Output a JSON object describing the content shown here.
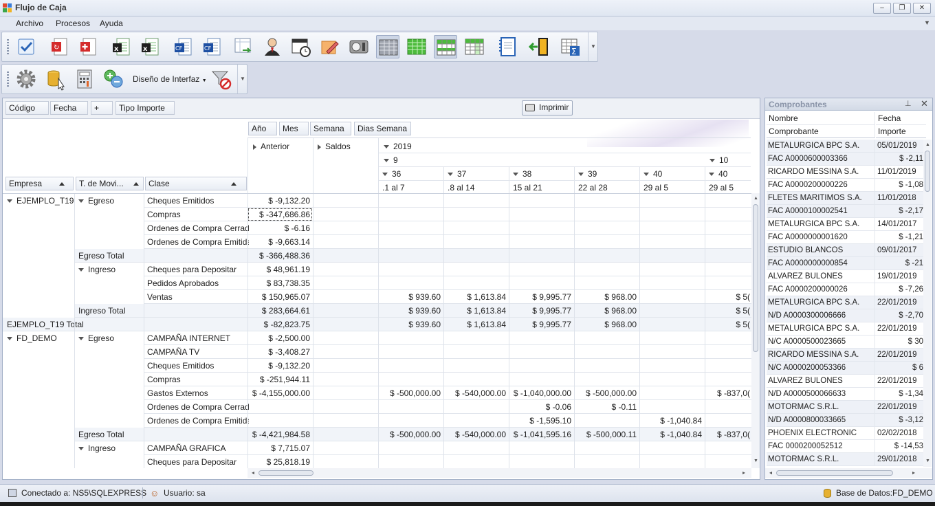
{
  "window": {
    "title": "Flujo de Caja"
  },
  "menu": [
    "Archivo",
    "Procesos",
    "Ayuda"
  ],
  "toolbar2": {
    "dropdown_label": "Diseño de Interfaz"
  },
  "filters": {
    "items": [
      "Código",
      "Fecha",
      "+",
      "Tipo Importe"
    ],
    "print_label": "Imprimir"
  },
  "pivot": {
    "date_fields": [
      "Año",
      "Mes",
      "Semana",
      "Dias Semana"
    ],
    "row_headers": [
      "Empresa",
      "T. de Movi...",
      "Clase"
    ],
    "col": {
      "anterior": "Anterior",
      "saldos": "Saldos",
      "year": "2019",
      "month9": "9",
      "month10": "10",
      "weeks": [
        "36",
        "37",
        "38",
        "39",
        "40",
        "40"
      ],
      "days": [
        ".1 al 7",
        ".8 al 14",
        "15 al 21",
        "22 al 28",
        "29 al 5",
        "29 al 5"
      ]
    },
    "rows": [
      {
        "e": "EJEMPLO_T19",
        "t": "Egreso",
        "c": "Cheques Emitidos",
        "v": [
          "$ -9,132.20",
          "",
          "",
          "",
          "",
          "",
          "",
          ""
        ]
      },
      {
        "e": "",
        "t": "",
        "c": "Compras",
        "v": [
          "$ -347,686.86",
          "",
          "",
          "",
          "",
          "",
          "",
          ""
        ]
      },
      {
        "e": "",
        "t": "",
        "c": "Ordenes de Compra Cerradas",
        "v": [
          "$ -6.16",
          "",
          "",
          "",
          "",
          "",
          "",
          ""
        ]
      },
      {
        "e": "",
        "t": "",
        "c": "Ordenes de Compra Emitidas",
        "v": [
          "$ -9,663.14",
          "",
          "",
          "",
          "",
          "",
          "",
          ""
        ]
      },
      {
        "total": "Egreso Total",
        "v": [
          "$ -366,488.36",
          "",
          "",
          "",
          "",
          "",
          "",
          ""
        ]
      },
      {
        "e": "",
        "t": "Ingreso",
        "c": "Cheques para Depositar",
        "v": [
          "$ 48,961.19",
          "",
          "",
          "",
          "",
          "",
          "",
          ""
        ]
      },
      {
        "e": "",
        "t": "",
        "c": "Pedidos Aprobados",
        "v": [
          "$ 83,738.35",
          "",
          "",
          "",
          "",
          "",
          "",
          ""
        ]
      },
      {
        "e": "",
        "t": "",
        "c": "Ventas",
        "v": [
          "$ 150,965.07",
          "",
          "$ 939.60",
          "$ 1,613.84",
          "$ 9,995.77",
          "$ 968.00",
          "",
          "$ 5("
        ]
      },
      {
        "total": "Ingreso Total",
        "v": [
          "$ 283,664.61",
          "",
          "$ 939.60",
          "$ 1,613.84",
          "$ 9,995.77",
          "$ 968.00",
          "",
          "$ 5("
        ]
      },
      {
        "gtotal": "EJEMPLO_T19 Total",
        "v": [
          "$ -82,823.75",
          "",
          "$ 939.60",
          "$ 1,613.84",
          "$ 9,995.77",
          "$ 968.00",
          "",
          "$ 5("
        ]
      },
      {
        "e": "FD_DEMO",
        "t": "Egreso",
        "c": "CAMPAÑA INTERNET",
        "v": [
          "$ -2,500.00",
          "",
          "",
          "",
          "",
          "",
          "",
          ""
        ]
      },
      {
        "e": "",
        "t": "",
        "c": "CAMPAÑA TV",
        "v": [
          "$ -3,408.27",
          "",
          "",
          "",
          "",
          "",
          "",
          ""
        ]
      },
      {
        "e": "",
        "t": "",
        "c": "Cheques Emitidos",
        "v": [
          "$ -9,132.20",
          "",
          "",
          "",
          "",
          "",
          "",
          ""
        ]
      },
      {
        "e": "",
        "t": "",
        "c": "Compras",
        "v": [
          "$ -251,944.11",
          "",
          "",
          "",
          "",
          "",
          "",
          ""
        ]
      },
      {
        "e": "",
        "t": "",
        "c": "Gastos Externos",
        "v": [
          "$ -4,155,000.00",
          "",
          "$ -500,000.00",
          "$ -540,000.00",
          "$ -1,040,000.00",
          "$ -500,000.00",
          "",
          "$ -837,0("
        ]
      },
      {
        "e": "",
        "t": "",
        "c": "Ordenes de Compra Cerradas",
        "v": [
          "",
          "",
          "",
          "",
          "$ -0.06",
          "$ -0.11",
          "",
          ""
        ]
      },
      {
        "e": "",
        "t": "",
        "c": "Ordenes de Compra Emitidas",
        "v": [
          "",
          "",
          "",
          "",
          "$ -1,595.10",
          "",
          "$ -1,040.84",
          ""
        ]
      },
      {
        "total": "Egreso Total",
        "v": [
          "$ -4,421,984.58",
          "",
          "$ -500,000.00",
          "$ -540,000.00",
          "$ -1,041,595.16",
          "$ -500,000.11",
          "$ -1,040.84",
          "$ -837,0("
        ]
      },
      {
        "e": "",
        "t": "Ingreso",
        "c": "CAMPAÑA GRAFICA",
        "v": [
          "$ 7,715.07",
          "",
          "",
          "",
          "",
          "",
          "",
          ""
        ]
      },
      {
        "e": "",
        "t": "",
        "c": "Cheques para Depositar",
        "v": [
          "$ 25,818.19",
          "",
          "",
          "",
          "",
          "",
          "",
          ""
        ]
      }
    ]
  },
  "comprobantes": {
    "title": "Comprobantes",
    "headers": [
      "Nombre",
      "Fecha",
      "Comprobante",
      "Importe"
    ],
    "rows": [
      [
        "METALURGICA BPC S.A.",
        "05/01/2019"
      ],
      [
        "FAC A0000600003366",
        "$ -2,11"
      ],
      [
        "RICARDO MESSINA S.A.",
        "11/01/2019"
      ],
      [
        "FAC A0000200000226",
        "$ -1,08"
      ],
      [
        "FLETES MARITIMOS S.A.",
        "11/01/2018"
      ],
      [
        "FAC A0000100002541",
        "$ -2,17"
      ],
      [
        "METALURGICA BPC S.A.",
        "14/01/2017"
      ],
      [
        "FAC A0000000001620",
        "$ -1,21"
      ],
      [
        "ESTUDIO BLANCOS",
        "09/01/2017"
      ],
      [
        "FAC A0000000000854",
        "$ -21"
      ],
      [
        "ALVAREZ BULONES",
        "19/01/2019"
      ],
      [
        "FAC A0000200000026",
        "$ -7,26"
      ],
      [
        "METALURGICA BPC S.A.",
        "22/01/2019"
      ],
      [
        "N/D A0000300006666",
        "$ -2,70"
      ],
      [
        "METALURGICA BPC S.A.",
        "22/01/2019"
      ],
      [
        "N/C A0000500023665",
        "$ 30"
      ],
      [
        "RICARDO MESSINA S.A.",
        "22/01/2019"
      ],
      [
        "N/C A0000200053366",
        "$ 6"
      ],
      [
        "ALVAREZ BULONES",
        "22/01/2019"
      ],
      [
        "N/D A0000500066633",
        "$ -1,34"
      ],
      [
        "MOTORMAC S.R.L.",
        "22/01/2019"
      ],
      [
        "N/D A0000800033665",
        "$ -3,12"
      ],
      [
        "PHOENIX ELECTRONIC",
        "02/02/2018"
      ],
      [
        "FAC  0000200052512",
        "$ -14,53"
      ],
      [
        "MOTORMAC S.R.L.",
        "29/01/2018"
      ]
    ]
  },
  "status": {
    "connection": "Conectado a: NS5\\SQLEXPRESS",
    "user": "Usuario: sa",
    "database": "Base de Datos:FD_DEMO"
  }
}
